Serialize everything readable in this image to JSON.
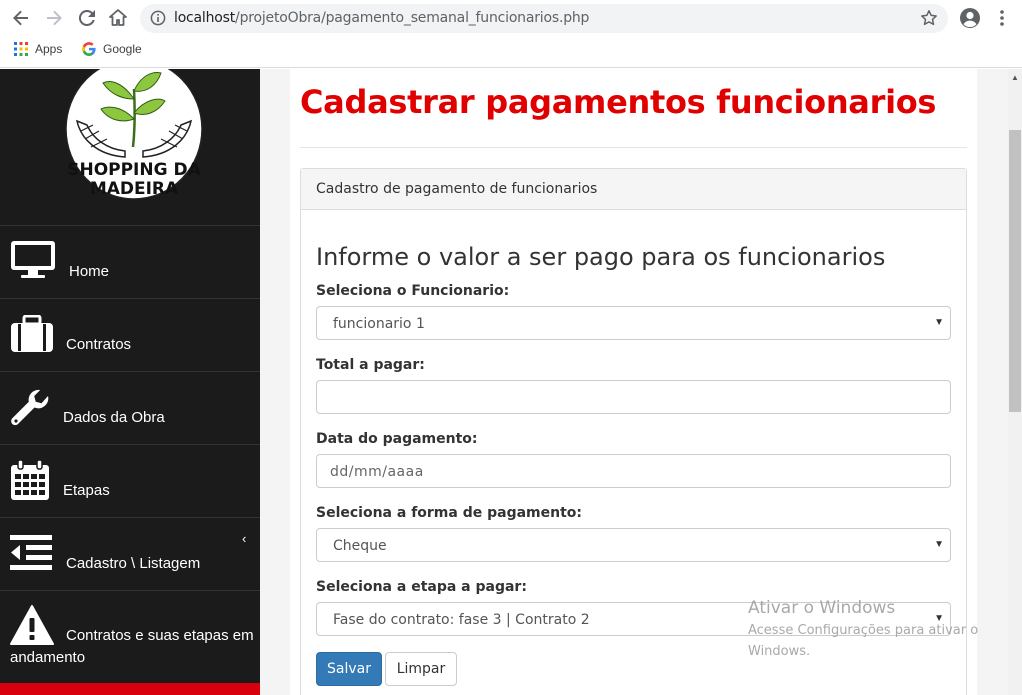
{
  "browser": {
    "url_host": "localhost",
    "url_path": "/projetoObra/pagamento_semanal_funcionarios.php",
    "bookmarks": [
      {
        "label": "Apps"
      },
      {
        "label": "Google"
      }
    ]
  },
  "sidebar": {
    "logo_text_line1": "SHOPPING DA",
    "logo_text_line2": "MADEIRA",
    "items": [
      {
        "label": "Home",
        "icon": "monitor-icon"
      },
      {
        "label": "Contratos",
        "icon": "briefcase-icon"
      },
      {
        "label": "Dados da Obra",
        "icon": "wrench-icon"
      },
      {
        "label": "Etapas",
        "icon": "calendar-icon"
      },
      {
        "label": "Cadastro \\ Listagem",
        "icon": "indent-list-icon",
        "has_chevron": true
      },
      {
        "label": "Contratos e suas etapas em andamento",
        "icon": "warning-icon"
      }
    ]
  },
  "page": {
    "title": "Cadastrar pagamentos funcionarios",
    "panel_heading": "Cadastro de pagamento de funcionarios",
    "form_heading": "Informe o valor a ser pago para os funcionarios",
    "fields": {
      "employee": {
        "label": "Seleciona o Funcionario:",
        "value": "funcionario 1"
      },
      "total": {
        "label": "Total a pagar:",
        "value": ""
      },
      "date": {
        "label": "Data do pagamento:",
        "placeholder": "dd/mm/aaaa"
      },
      "method": {
        "label": "Seleciona a forma de pagamento:",
        "value": "Cheque"
      },
      "stage": {
        "label": "Seleciona a etapa a pagar:",
        "value": "Fase do contrato: fase 3 | Contrato 2"
      }
    },
    "buttons": {
      "save": "Salvar",
      "clear": "Limpar"
    }
  },
  "watermark": {
    "title": "Ativar o Windows",
    "subtitle": "Acesse Configurações para ativar o Windows."
  },
  "colors": {
    "title_red": "#e00000",
    "sidebar_bg": "#1b1b1b",
    "primary_blue": "#337ab7"
  }
}
